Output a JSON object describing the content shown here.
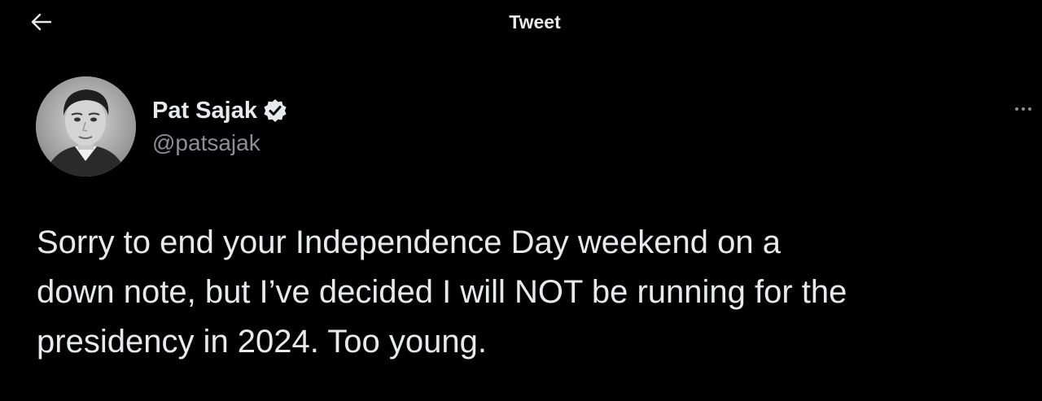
{
  "header": {
    "title": "Tweet",
    "back_icon": "arrow-left-icon"
  },
  "author": {
    "display_name": "Pat Sajak",
    "handle": "@patsajak",
    "verified": true,
    "verified_icon": "verified-badge-icon"
  },
  "tweet": {
    "text": "Sorry to end your Independence Day weekend on a\ndown note, but I’ve decided I will NOT be running for the\npresidency in 2024. Too young.",
    "more_icon": "more-options-icon"
  },
  "colors": {
    "background": "#000000",
    "text_primary": "#e7e9ea",
    "text_secondary": "#8b9096",
    "badge": "#e7e9ea"
  }
}
